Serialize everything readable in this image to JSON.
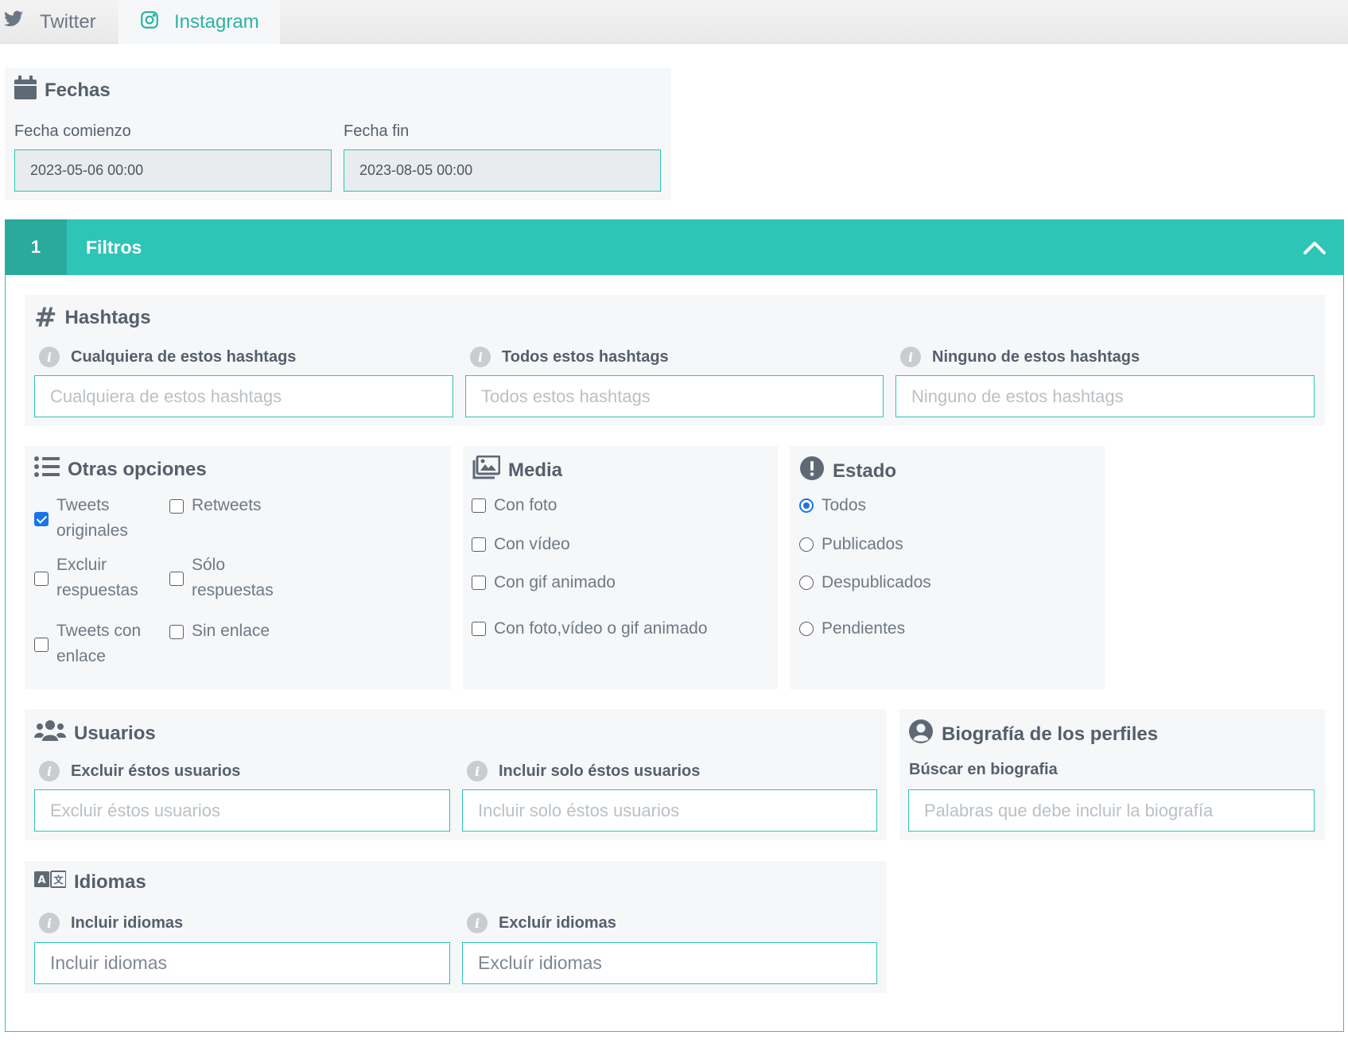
{
  "tabs": [
    {
      "label": "Twitter",
      "icon": "twitter-icon",
      "active": false
    },
    {
      "label": "Instagram",
      "icon": "instagram-icon",
      "active": true
    }
  ],
  "fechas": {
    "title": "Fechas",
    "start_label": "Fecha comienzo",
    "start_value": "2023-05-06 00:00",
    "end_label": "Fecha fin",
    "end_value": "2023-08-05 00:00"
  },
  "filtros": {
    "number": "1",
    "title": "Filtros",
    "hashtags": {
      "title": "Hashtags",
      "any_label": "Cualquiera de estos hashtags",
      "any_placeholder": "Cualquiera de estos hashtags",
      "all_label": "Todos estos hashtags",
      "all_placeholder": "Todos estos hashtags",
      "none_label": "Ninguno de estos hashtags",
      "none_placeholder": "Ninguno de estos hashtags"
    },
    "otras": {
      "title": "Otras opciones",
      "options": [
        {
          "label": "Tweets originales",
          "checked": true
        },
        {
          "label": "Retweets",
          "checked": false
        },
        {
          "label": "Excluir respuestas",
          "checked": false
        },
        {
          "label": "Sólo respuestas",
          "checked": false
        },
        {
          "label": "Tweets con enlace",
          "checked": false
        },
        {
          "label": "Sin enlace",
          "checked": false
        }
      ]
    },
    "media": {
      "title": "Media",
      "options": [
        {
          "label": "Con foto",
          "checked": false
        },
        {
          "label": "Con vídeo",
          "checked": false
        },
        {
          "label": "Con gif animado",
          "checked": false
        },
        {
          "label": "Con foto,vídeo o gif animado",
          "checked": false
        }
      ]
    },
    "estado": {
      "title": "Estado",
      "options": [
        {
          "label": "Todos",
          "selected": true
        },
        {
          "label": "Publicados",
          "selected": false
        },
        {
          "label": "Despublicados",
          "selected": false
        },
        {
          "label": "Pendientes",
          "selected": false
        }
      ]
    },
    "usuarios": {
      "title": "Usuarios",
      "exclude_label": "Excluir éstos usuarios",
      "exclude_placeholder": "Excluir éstos usuarios",
      "include_label": "Incluir solo éstos usuarios",
      "include_placeholder": "Incluir solo éstos usuarios"
    },
    "biografia": {
      "title": "Biografía de los perfiles",
      "search_label": "Búscar en biografia",
      "search_placeholder": "Palabras que debe incluir la biografía"
    },
    "idiomas": {
      "title": "Idiomas",
      "include_label": "Incluir idiomas",
      "include_placeholder": "Incluir idiomas",
      "exclude_label": "Excluír idiomas",
      "exclude_placeholder": "Excluír idiomas"
    }
  },
  "colors": {
    "accent": "#2ec4b6",
    "accent_dark": "#29aa9d",
    "panel_bg": "#f5f7f9",
    "checkbox_checked": "#1a73e8"
  }
}
